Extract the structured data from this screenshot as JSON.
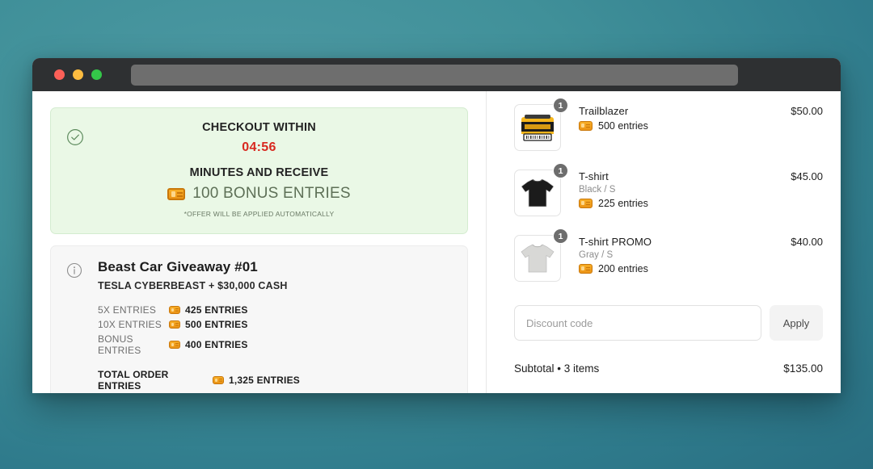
{
  "window": {
    "traffic_lights": [
      "close",
      "minimize",
      "maximize"
    ],
    "url_value": ""
  },
  "promo": {
    "icon": "check-circle-icon",
    "line1": "CHECKOUT WITHIN",
    "timer": "04:56",
    "line2": "MINUTES AND RECEIVE",
    "bonus": "100 BONUS ENTRIES",
    "bonus_icon": "ticket-icon",
    "fine_print": "*OFFER WILL BE APPLIED AUTOMATICALLY",
    "bg_color": "#eaf8e6",
    "timer_color": "#d8281f",
    "bonus_color": "#5e7057"
  },
  "giveaway": {
    "icon": "info-circle-icon",
    "title": "Beast Car Giveaway #01",
    "subtitle": "TESLA CYBERBEAST + $30,000 CASH",
    "rows": [
      {
        "label": "5X ENTRIES",
        "value": "425 ENTRIES"
      },
      {
        "label": "10X ENTRIES",
        "value": "500 ENTRIES"
      },
      {
        "label": "BONUS ENTRIES",
        "value": "400 ENTRIES"
      }
    ],
    "total": {
      "label": "TOTAL ORDER ENTRIES",
      "value": "1,325 ENTRIES"
    }
  },
  "cart": {
    "items": [
      {
        "thumb": "yellow-toolbox-thumbnail",
        "qty": "1",
        "title": "Trailblazer",
        "variant": "",
        "entries": "500 entries",
        "price": "$50.00"
      },
      {
        "thumb": "black-tshirt-thumbnail",
        "qty": "1",
        "title": "T-shirt",
        "variant": "Black / S",
        "entries": "225 entries",
        "price": "$45.00"
      },
      {
        "thumb": "gray-tshirt-thumbnail",
        "qty": "1",
        "title": "T-shirt PROMO",
        "variant": "Gray / S",
        "entries": "200 entries",
        "price": "$40.00"
      }
    ],
    "discount": {
      "placeholder": "Discount code",
      "value": "",
      "apply_label": "Apply"
    },
    "subtotal_label": "Subtotal • 3 items",
    "subtotal_amount": "$135.00"
  },
  "theme": {
    "accent_orange": "#eb9417",
    "background_teal": "#409099"
  }
}
